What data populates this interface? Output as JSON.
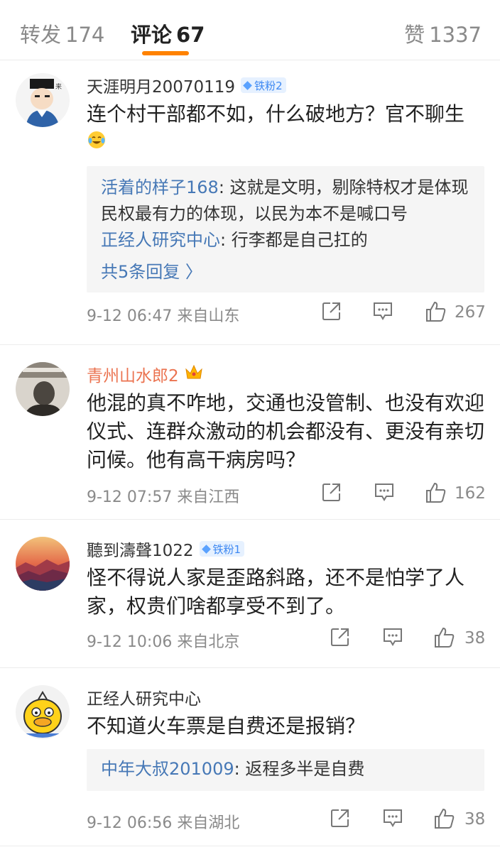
{
  "tabs": {
    "repost_label": "转发",
    "repost_count": "174",
    "comments_label": "评论",
    "comments_count": "67",
    "likes_label": "赞",
    "likes_count": "1337"
  },
  "colors": {
    "accent": "#ff8200",
    "link": "#4678b6",
    "vip_name": "#eb7350",
    "badge": "#3d88f2"
  },
  "comments": [
    {
      "name": "天涯明月20070119",
      "badge": "铁粉2",
      "text": "连个村干部都不如，什么破地方？官不聊生",
      "emoji": "laughing-crying-emoji",
      "replies": [
        {
          "name": "活着的样子168",
          "text": ": 这就是文明，剔除特权才是体现民权最有力的体现，以民为本不是喊口号"
        },
        {
          "name": "正经人研究中心",
          "text": ": 行李都是自己扛的"
        }
      ],
      "more_replies": "共5条回复 〉",
      "time": "9-12 06:47 来自山东",
      "likes": "267"
    },
    {
      "name": "青州山水郎2",
      "vip_icon": "crown-icon",
      "text": "他混的真不咋地，交通也没管制、也没有欢迎仪式、连群众激动的机会都没有、更没有亲切问候。他有高干病房吗？",
      "time": "9-12 07:57 来自江西",
      "likes": "162"
    },
    {
      "name": "聽到濤聲1022",
      "badge": "铁粉1",
      "text": "怪不得说人家是歪路斜路，还不是怕学了人家，权贵们啥都享受不到了。",
      "time": "9-12 10:06 来自北京",
      "likes": "38"
    },
    {
      "name": "正经人研究中心",
      "text": "不知道火车票是自费还是报销？",
      "replies": [
        {
          "name": "中年大叔201009",
          "text": ": 返程多半是自费"
        }
      ],
      "time": "9-12 06:56 来自湖北",
      "likes": "38"
    }
  ]
}
